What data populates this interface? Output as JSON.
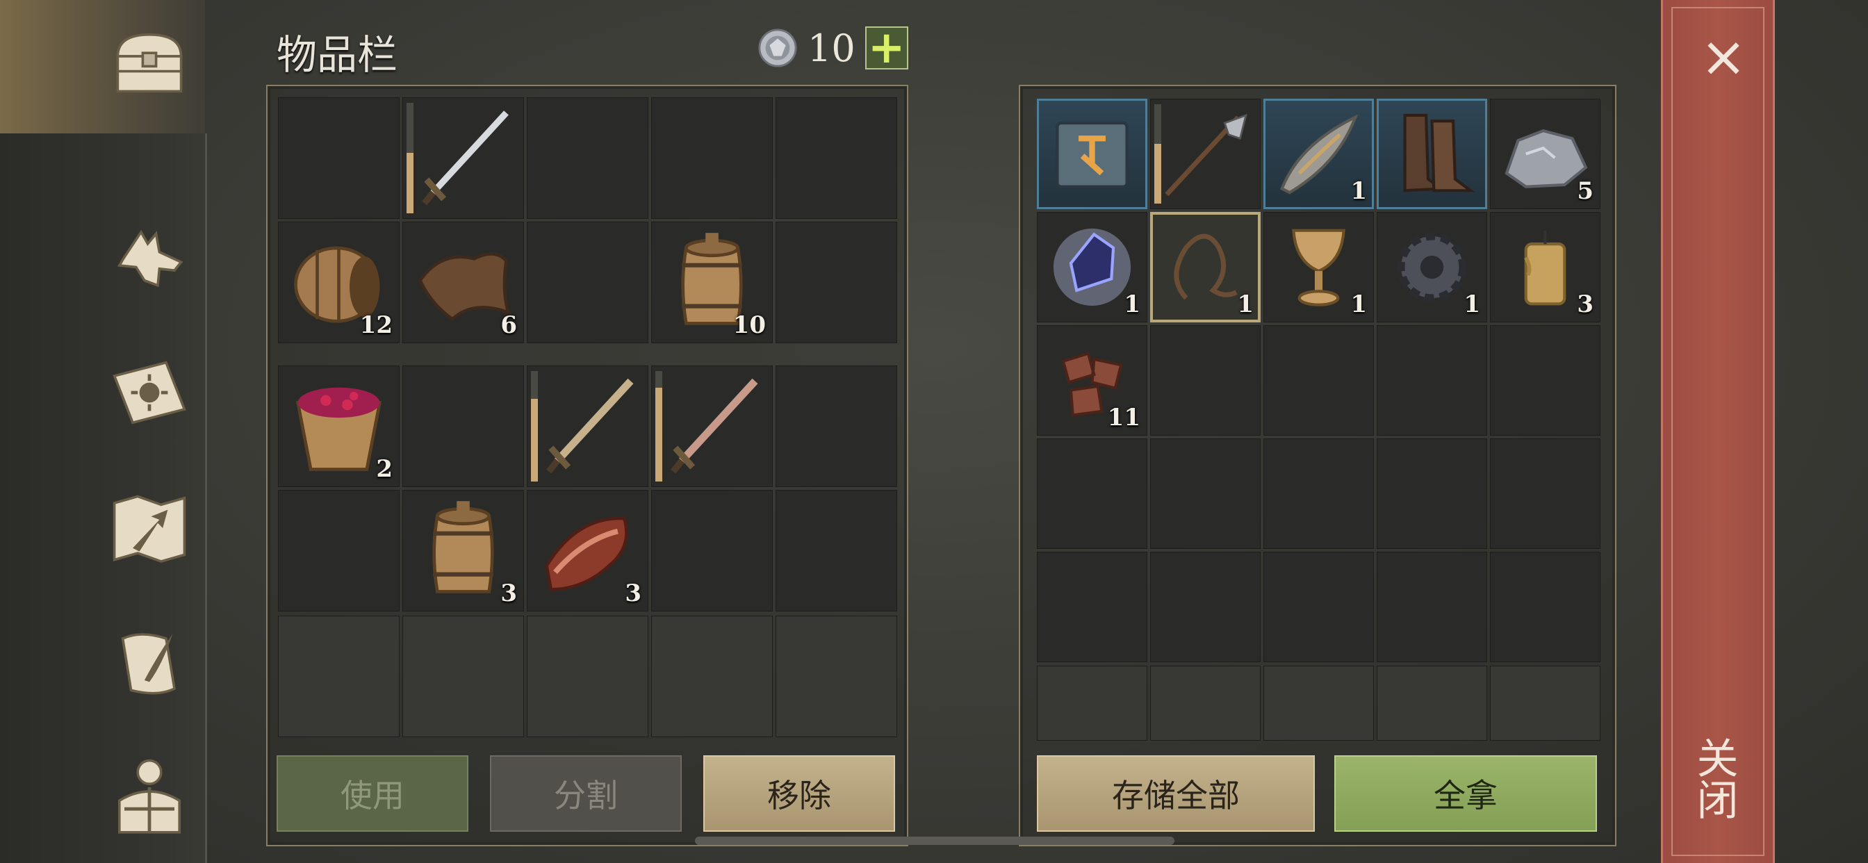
{
  "header": {
    "title": "物品栏",
    "currency_value": "10",
    "currency_icon": "gem-coin-icon",
    "plus_label": "+"
  },
  "sidebar": {
    "items": [
      {
        "name": "chest-icon"
      },
      {
        "name": "wolf-icon"
      },
      {
        "name": "skill-book-icon"
      },
      {
        "name": "map-icon"
      },
      {
        "name": "scroll-quill-icon"
      },
      {
        "name": "character-gear-icon"
      }
    ]
  },
  "inventory": {
    "slots_top": [
      {
        "item": "",
        "qty": ""
      },
      {
        "item": "sword",
        "qty": "",
        "durability": 0.55
      },
      {
        "item": "",
        "qty": ""
      },
      {
        "item": "",
        "qty": ""
      },
      {
        "item": "",
        "qty": ""
      },
      {
        "item": "empty-barrel",
        "qty": "12"
      },
      {
        "item": "leather-scrap",
        "qty": "6"
      },
      {
        "item": "",
        "qty": ""
      },
      {
        "item": "barrel",
        "qty": "10"
      },
      {
        "item": "",
        "qty": ""
      }
    ],
    "slots_bottom": [
      {
        "item": "berry-bucket",
        "qty": "2"
      },
      {
        "item": "",
        "qty": ""
      },
      {
        "item": "bronze-sword",
        "qty": "",
        "durability": 0.75
      },
      {
        "item": "copper-sword",
        "qty": "",
        "durability": 0.85
      },
      {
        "item": "",
        "qty": ""
      },
      {
        "item": "",
        "qty": ""
      },
      {
        "item": "barrel",
        "qty": "3"
      },
      {
        "item": "raw-meat",
        "qty": "3"
      },
      {
        "item": "",
        "qty": ""
      },
      {
        "item": "",
        "qty": ""
      }
    ],
    "buttons": {
      "use": "使用",
      "split": "分割",
      "remove": "移除"
    }
  },
  "container": {
    "slots": [
      {
        "item": "recipe-book",
        "qty": "",
        "highlight": "blue"
      },
      {
        "item": "halberd",
        "qty": "",
        "durability": 0.6
      },
      {
        "item": "ornate-bow",
        "qty": "1",
        "highlight": "blue"
      },
      {
        "item": "boots",
        "qty": "",
        "highlight": "blue"
      },
      {
        "item": "iron-ore",
        "qty": "5"
      },
      {
        "item": "dark-crystal",
        "qty": "1"
      },
      {
        "item": "whip",
        "qty": "1",
        "highlight": "selected"
      },
      {
        "item": "chalice",
        "qty": "1"
      },
      {
        "item": "gear",
        "qty": "1"
      },
      {
        "item": "candle",
        "qty": "3"
      },
      {
        "item": "rune-fragments",
        "qty": "11"
      }
    ],
    "buttons": {
      "store_all": "存储全部",
      "take_all": "全拿"
    }
  },
  "close": {
    "x_label": "×",
    "label": "关闭"
  },
  "colors": {
    "accent_green": "#9bb46a",
    "close_red": "#a95648",
    "gold_button": "#c3b28c"
  }
}
